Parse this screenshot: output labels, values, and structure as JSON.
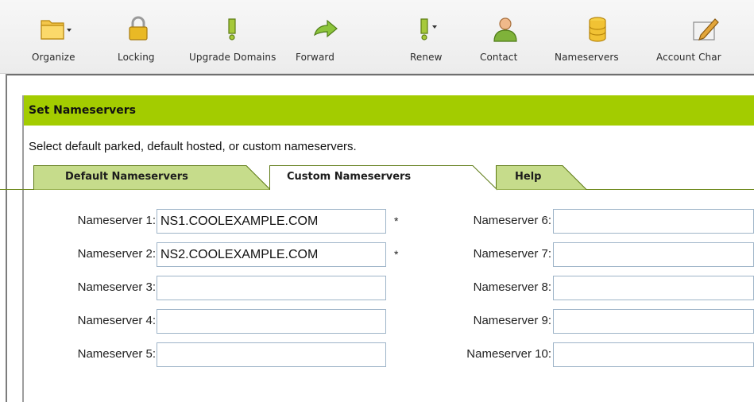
{
  "toolbar": {
    "items": [
      {
        "label": "Organize",
        "icon": "folder-icon"
      },
      {
        "label": "Locking",
        "icon": "lock-icon"
      },
      {
        "label": "Upgrade Domains",
        "icon": "upgrade-icon"
      },
      {
        "label": "Forward",
        "icon": "forward-arrow-icon"
      },
      {
        "label": "Renew",
        "icon": "renew-icon"
      },
      {
        "label": "Contact",
        "icon": "contact-person-icon"
      },
      {
        "label": "Nameservers",
        "icon": "database-icon"
      },
      {
        "label": "Account Char",
        "icon": "edit-pencil-icon"
      }
    ]
  },
  "panel": {
    "title": "Set Nameservers",
    "instruction": "Select default parked, default hosted, or custom nameservers.",
    "header_color": "#a3cc00"
  },
  "tabs": [
    {
      "label": "Default Nameservers",
      "active": false
    },
    {
      "label": "Custom Nameservers",
      "active": true
    },
    {
      "label": "Help",
      "active": false
    }
  ],
  "form": {
    "left": [
      {
        "label": "Nameserver 1:",
        "value": "NS1.COOLEXAMPLE.COM",
        "required": "*"
      },
      {
        "label": "Nameserver 2:",
        "value": "NS2.COOLEXAMPLE.COM",
        "required": "*"
      },
      {
        "label": "Nameserver 3:",
        "value": ""
      },
      {
        "label": "Nameserver 4:",
        "value": ""
      },
      {
        "label": "Nameserver 5:",
        "value": ""
      }
    ],
    "right": [
      {
        "label": "Nameserver 6:",
        "value": ""
      },
      {
        "label": "Nameserver 7:",
        "value": ""
      },
      {
        "label": "Nameserver 8:",
        "value": ""
      },
      {
        "label": "Nameserver 9:",
        "value": ""
      },
      {
        "label": "Nameserver 10:",
        "value": ""
      }
    ]
  }
}
